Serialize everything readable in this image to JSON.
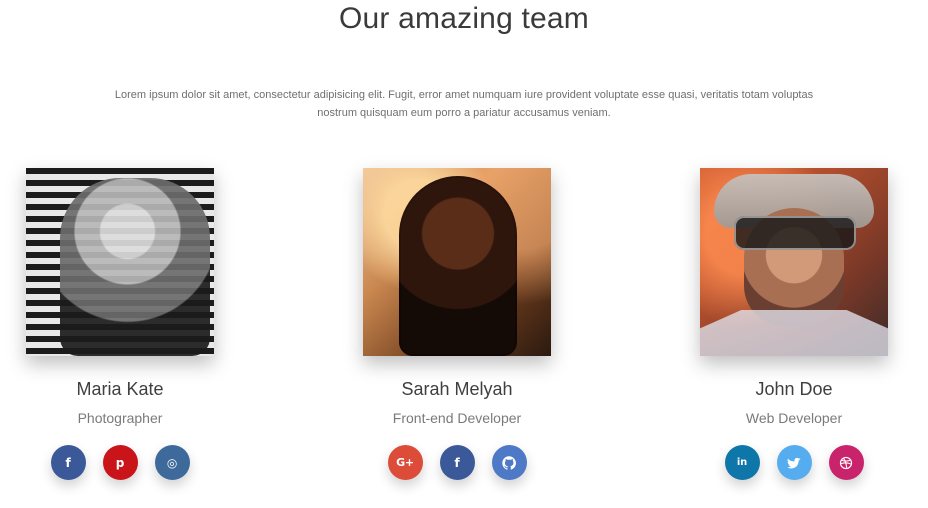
{
  "header": {
    "title": "Our amazing team",
    "description": "Lorem ipsum dolor sit amet, consectetur adipisicing elit. Fugit, error amet numquam iure provident voluptate esse quasi, veritatis totam voluptas nostrum quisquam eum porro a pariatur accusamus veniam."
  },
  "team": [
    {
      "name": "Maria Kate",
      "role": "Photographer",
      "socials": [
        {
          "icon": "facebook-icon",
          "glyph": "f",
          "color": "#3b5998"
        },
        {
          "icon": "pinterest-icon",
          "glyph": "p",
          "color": "#c9141a"
        },
        {
          "icon": "instagram-icon",
          "glyph": "◎",
          "color": "#3d6a9b"
        }
      ]
    },
    {
      "name": "Sarah Melyah",
      "role": "Front-end Developer",
      "socials": [
        {
          "icon": "google-plus-icon",
          "glyph": "G+",
          "color": "#dd4b39"
        },
        {
          "icon": "facebook-icon",
          "glyph": "f",
          "color": "#3b5998"
        },
        {
          "icon": "github-icon",
          "glyph": "",
          "color": "#4e79c6"
        }
      ]
    },
    {
      "name": "John Doe",
      "role": "Web Developer",
      "socials": [
        {
          "icon": "linkedin-icon",
          "glyph": "in",
          "color": "#0e76a8"
        },
        {
          "icon": "twitter-icon",
          "glyph": "",
          "color": "#55acee"
        },
        {
          "icon": "dribbble-icon",
          "glyph": "",
          "color": "#c9246b"
        }
      ]
    }
  ]
}
